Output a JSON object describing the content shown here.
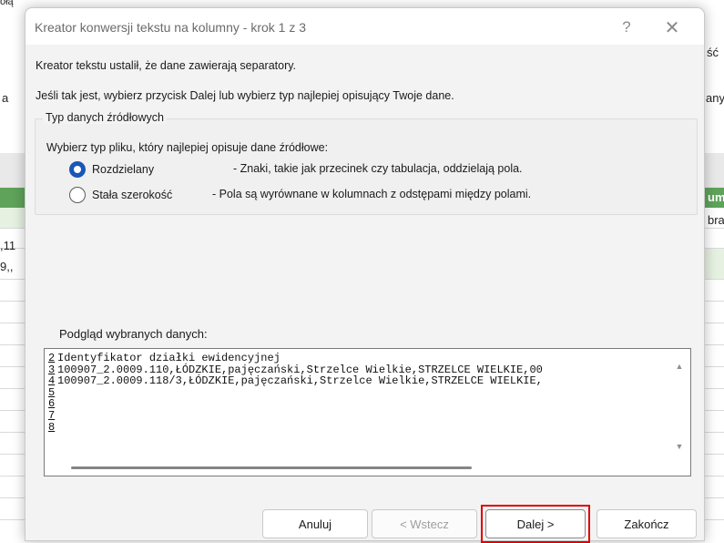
{
  "background_sheet": {
    "fragments": [
      "ołą",
      "a",
      "ść",
      "any",
      ",11",
      "9,,",
      "um",
      "bra"
    ]
  },
  "dialog": {
    "title": "Kreator konwersji tekstu na kolumny - krok 1 z 3",
    "help_glyph": "?",
    "close_glyph": "✕",
    "info_line_1": "Kreator tekstu ustalił, że dane zawierają separatory.",
    "info_line_2": "Jeśli tak jest, wybierz przycisk Dalej lub wybierz typ najlepiej opisujący Twoje dane.",
    "group": {
      "legend": "Typ danych źródłowych",
      "prompt": "Wybierz typ pliku, który najlepiej opisuje dane źródłowe:",
      "options": [
        {
          "label": "Rozdzielany",
          "description": "- Znaki, takie jak przecinek czy tabulacja, oddzielają pola.",
          "checked": true
        },
        {
          "label": "Stała szerokość",
          "description": "- Pola są wyrównane w kolumnach z odstępami między polami.",
          "checked": false
        }
      ]
    },
    "preview": {
      "label": "Podgląd wybranych danych:",
      "lines": [
        {
          "num": "2",
          "text": "Identyfikator działki ewidencyjnej"
        },
        {
          "num": "3",
          "text": "100907_2.0009.110,ŁÓDZKIE,pajęczański,Strzelce Wielkie,STRZELCE WIELKIE,00"
        },
        {
          "num": "4",
          "text": "100907_2.0009.118/3,ŁÓDZKIE,pajęczański,Strzelce Wielkie,STRZELCE WIELKIE,"
        },
        {
          "num": "5",
          "text": ""
        },
        {
          "num": "6",
          "text": ""
        },
        {
          "num": "7",
          "text": ""
        },
        {
          "num": "8",
          "text": ""
        }
      ]
    },
    "buttons": {
      "cancel": "Anuluj",
      "back": "< Wstecz",
      "next": "Dalej >",
      "finish": "Zakończ"
    },
    "highlight_color": "#e00000",
    "radio_color": "#1a56b8"
  }
}
